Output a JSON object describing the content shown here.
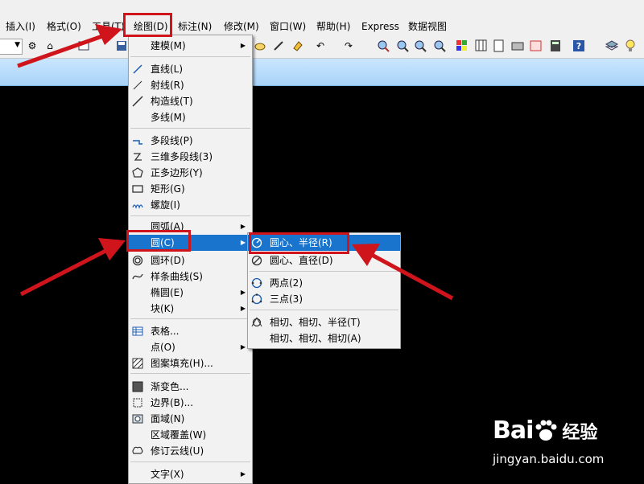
{
  "menubar": {
    "items": [
      "插入(I)",
      "格式(O)",
      "工具(T)",
      "绘图(D)",
      "标注(N)",
      "修改(M)",
      "窗口(W)",
      "帮助(H)",
      "Express",
      "数据视图"
    ]
  },
  "draw_menu": {
    "items": [
      {
        "label": "建模(M)",
        "submenu": true
      },
      {
        "label": "直线(L)"
      },
      {
        "label": "射线(R)"
      },
      {
        "label": "构造线(T)"
      },
      {
        "label": "多线(M)"
      },
      {
        "label": "多段线(P)"
      },
      {
        "label": "三维多段线(3)"
      },
      {
        "label": "正多边形(Y)"
      },
      {
        "label": "矩形(G)"
      },
      {
        "label": "螺旋(I)"
      },
      {
        "label": "圆弧(A)",
        "submenu": true
      },
      {
        "label": "圆(C)",
        "submenu": true,
        "highlighted": true
      },
      {
        "label": "圆环(D)"
      },
      {
        "label": "样条曲线(S)"
      },
      {
        "label": "椭圆(E)",
        "submenu": true
      },
      {
        "label": "块(K)",
        "submenu": true
      },
      {
        "label": "表格..."
      },
      {
        "label": "点(O)",
        "submenu": true
      },
      {
        "label": "图案填充(H)..."
      },
      {
        "label": "渐变色..."
      },
      {
        "label": "边界(B)..."
      },
      {
        "label": "面域(N)"
      },
      {
        "label": "区域覆盖(W)"
      },
      {
        "label": "修订云线(U)"
      },
      {
        "label": "文字(X)",
        "submenu": true
      }
    ]
  },
  "circle_submenu": {
    "items": [
      {
        "label": "圆心、半径(R)",
        "highlighted": true
      },
      {
        "label": "圆心、直径(D)"
      },
      {
        "label": "两点(2)"
      },
      {
        "label": "三点(3)"
      },
      {
        "label": "相切、相切、半径(T)"
      },
      {
        "label": "相切、相切、相切(A)"
      }
    ]
  },
  "watermark": {
    "brand_text": "Bai",
    "brand_cn": "经验",
    "url": "jingyan.baidu.com"
  },
  "colors": {
    "highlight": "#1874cd",
    "annotation_red": "#d0141b",
    "canvas": "#000000",
    "titlebar": "#b8dcfb"
  },
  "icons": {
    "toolbar": [
      "dropdown-icon",
      "gear-icon",
      "home-icon",
      "rectangle-icon",
      "cursor-icon",
      "save-icon",
      "cloud-icon",
      "pencil-icon",
      "eraser-icon",
      "undo-icon",
      "redo-icon",
      "zoom-realtime-icon",
      "zoom-window-icon",
      "zoom-previous-icon",
      "zoom-extents-icon",
      "palette-icon",
      "grid-icon",
      "design-center-icon",
      "tool-palette-icon",
      "sheet-set-icon",
      "markup-icon",
      "calculator-icon",
      "help-icon",
      "layers-icon",
      "bulb-icon"
    ]
  }
}
